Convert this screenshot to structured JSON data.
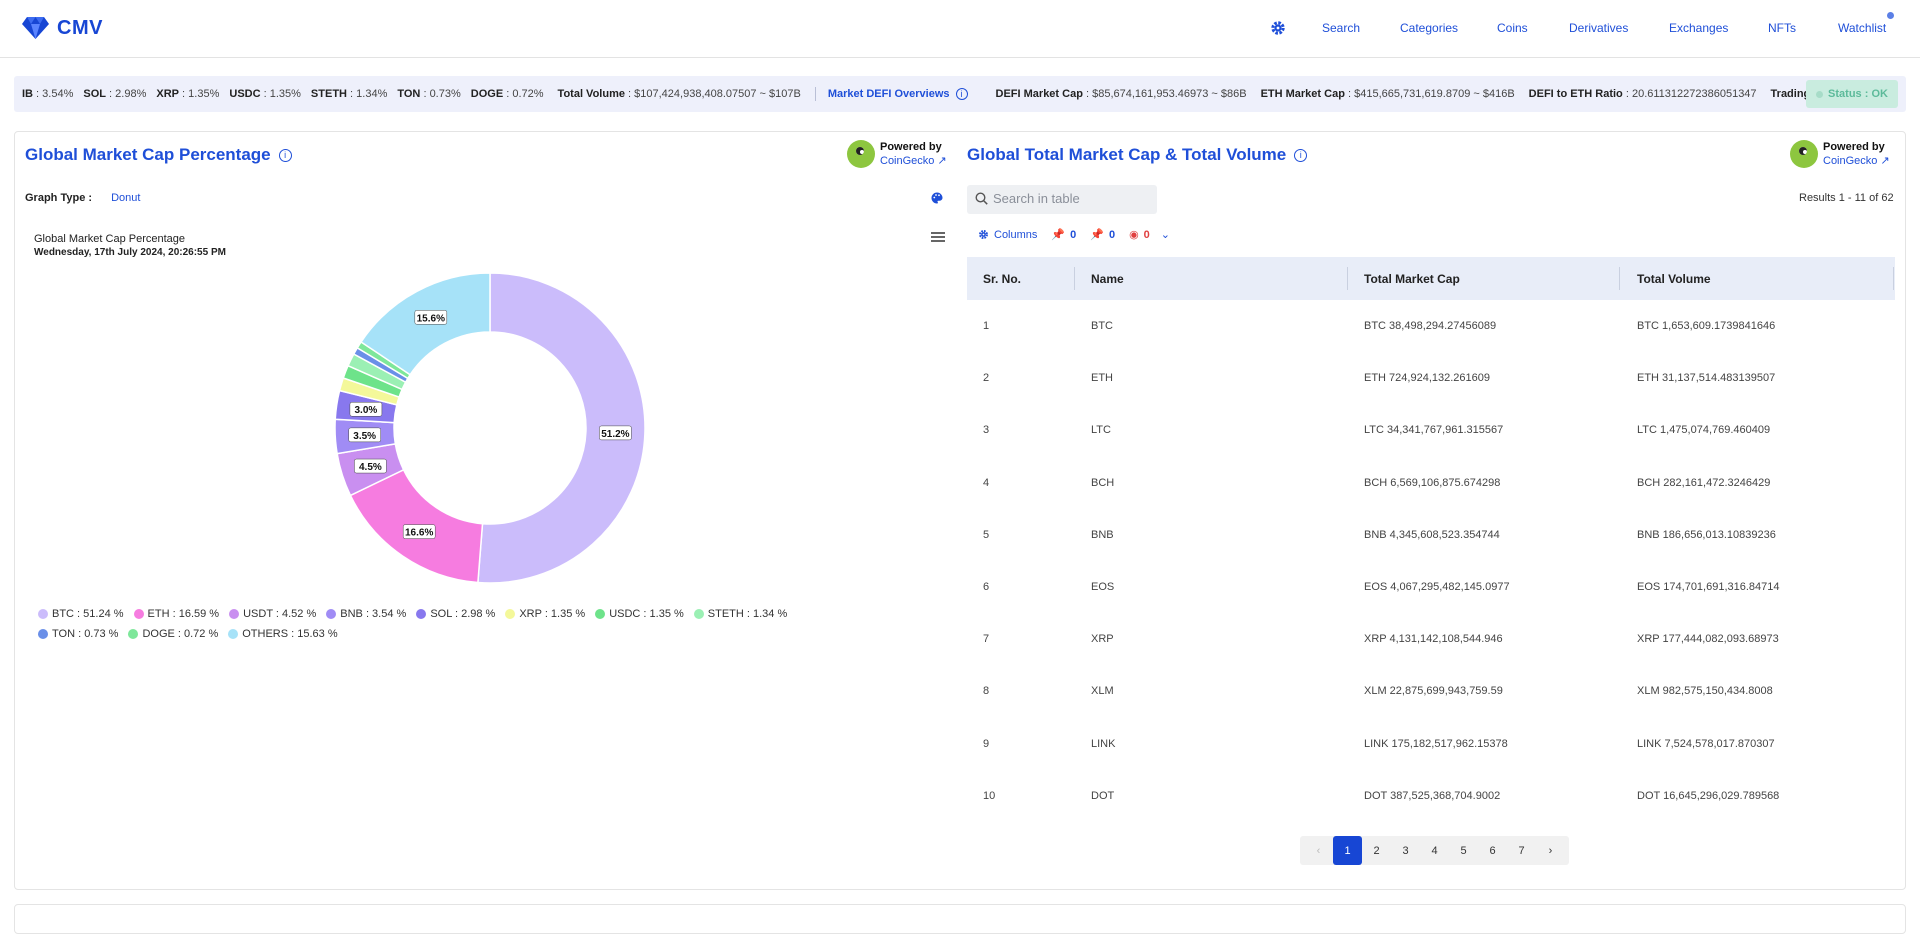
{
  "nav": {
    "logo_text": "CMV",
    "links": [
      "Search",
      "Categories",
      "Coins",
      "Derivatives",
      "Exchanges",
      "NFTs",
      "Watchlist"
    ]
  },
  "ticker": {
    "items": [
      {
        "label": "IB",
        "value": "3.54%"
      },
      {
        "label": "SOL",
        "value": "2.98%"
      },
      {
        "label": "XRP",
        "value": "1.35%"
      },
      {
        "label": "USDC",
        "value": "1.35%"
      },
      {
        "label": "STETH",
        "value": "1.34%"
      },
      {
        "label": "TON",
        "value": "0.73%"
      },
      {
        "label": "DOGE",
        "value": "0.72%"
      },
      {
        "label": "Total Volume",
        "value": "$107,424,938,408.07507 ~ $107B"
      }
    ],
    "defi_link": "Market DEFI Overviews",
    "defi_items": [
      {
        "label": "DEFI Market Cap",
        "value": "$85,674,161,953.46973 ~ $86B"
      },
      {
        "label": "ETH Market Cap",
        "value": "$415,665,731,619.8709 ~ $416B"
      },
      {
        "label": "DEFI to ETH Ratio",
        "value": "20.611312272386051347"
      },
      {
        "label": "Trading Vo",
        "value": ""
      }
    ],
    "status": "Status : OK"
  },
  "left": {
    "title": "Global Market Cap Percentage",
    "powered_by": "Powered by",
    "coingecko": "CoinGecko",
    "graph_type_label": "Graph Type :",
    "graph_type_value": "Donut",
    "chart_title": "Global Market Cap Percentage",
    "chart_subtitle": "Wednesday, 17th July 2024, 20:26:55 PM"
  },
  "chart_data": {
    "type": "pie",
    "title": "Global Market Cap Percentage",
    "subtitle": "Wednesday, 17th July 2024, 20:26:55 PM",
    "donut": true,
    "categories": [
      "BTC",
      "ETH",
      "USDT",
      "BNB",
      "SOL",
      "XRP",
      "USDC",
      "STETH",
      "TON",
      "DOGE",
      "OTHERS"
    ],
    "values": [
      51.24,
      16.59,
      4.52,
      3.54,
      2.98,
      1.35,
      1.35,
      1.34,
      0.73,
      0.72,
      15.63
    ],
    "colors": [
      "#cbbcfb",
      "#f67ce0",
      "#c98ff0",
      "#a08cf5",
      "#8878ee",
      "#f4f89a",
      "#6ee38a",
      "#9bf0b4",
      "#6a8fe8",
      "#7ee79a",
      "#a6e2f8"
    ],
    "data_labels": [
      "51.2%",
      "16.6%",
      "4.5%",
      "3.5%",
      "3.0%",
      "",
      "",
      "",
      "",
      "",
      "15.6%"
    ],
    "legend_text": [
      "BTC : 51.24 %",
      "ETH : 16.59 %",
      "USDT : 4.52 %",
      "BNB : 3.54 %",
      "SOL : 2.98 %",
      "XRP : 1.35 %",
      "USDC : 1.35 %",
      "STETH : 1.34 %",
      "TON : 0.73 %",
      "DOGE : 0.72 %",
      "OTHERS : 15.63 %"
    ],
    "legend_position": "bottom-left"
  },
  "right": {
    "title": "Global Total Market Cap & Total Volume",
    "powered_by": "Powered by",
    "coingecko": "CoinGecko",
    "search_placeholder": "Search in table",
    "results": "Results 1 - 11 of 62",
    "toolbar": {
      "columns": "Columns",
      "pinned": "0",
      "pinned2": "0",
      "hidden": "0"
    },
    "columns": [
      "Sr. No.",
      "Name",
      "Total Market Cap",
      "Total Volume"
    ],
    "rows": [
      [
        "1",
        "BTC",
        "BTC 38,498,294.27456089",
        "BTC 1,653,609.1739841646"
      ],
      [
        "2",
        "ETH",
        "ETH 724,924,132.261609",
        "ETH 31,137,514.483139507"
      ],
      [
        "3",
        "LTC",
        "LTC 34,341,767,961.315567",
        "LTC 1,475,074,769.460409"
      ],
      [
        "4",
        "BCH",
        "BCH 6,569,106,875.674298",
        "BCH 282,161,472.3246429"
      ],
      [
        "5",
        "BNB",
        "BNB 4,345,608,523.354744",
        "BNB 186,656,013.10839236"
      ],
      [
        "6",
        "EOS",
        "EOS 4,067,295,482,145.0977",
        "EOS 174,701,691,316.84714"
      ],
      [
        "7",
        "XRP",
        "XRP 4,131,142,108,544.946",
        "XRP 177,444,082,093.68973"
      ],
      [
        "8",
        "XLM",
        "XLM 22,875,699,943,759.59",
        "XLM 982,575,150,434.8008"
      ],
      [
        "9",
        "LINK",
        "LINK 175,182,517,962.15378",
        "LINK 7,524,578,017.870307"
      ],
      [
        "10",
        "DOT",
        "DOT 387,525,368,704.9002",
        "DOT 16,645,296,029.789568"
      ]
    ],
    "pages": [
      "1",
      "2",
      "3",
      "4",
      "5",
      "6",
      "7"
    ],
    "prev": "‹",
    "next": "›"
  }
}
